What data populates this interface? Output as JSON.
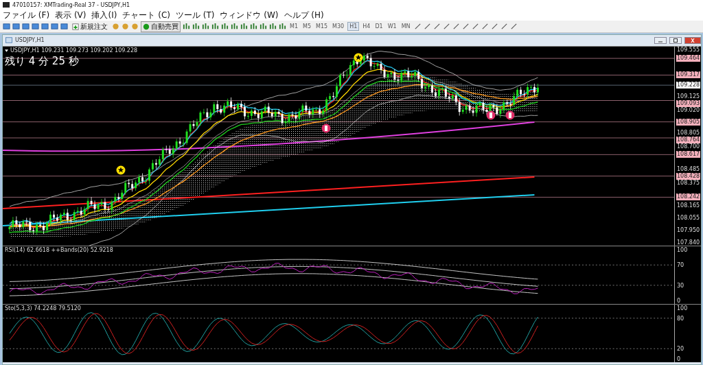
{
  "window": {
    "title": "47010157: XMTrading-Real 37 - USDJPY,H1"
  },
  "menu": [
    "ファイル (F)",
    "表示 (V)",
    "挿入(I)",
    "チャート (C)",
    "ツール (T)",
    "ウィンドウ (W)",
    "ヘルプ (H)"
  ],
  "toolbar": {
    "new_order": "新規注文",
    "auto_trading": {
      "label": "自動売買",
      "on": true
    },
    "timeframes": [
      {
        "label": "M1",
        "selected": false
      },
      {
        "label": "M5",
        "selected": false
      },
      {
        "label": "M15",
        "selected": false
      },
      {
        "label": "M30",
        "selected": false
      },
      {
        "label": "H1",
        "selected": true
      },
      {
        "label": "H4",
        "selected": false
      },
      {
        "label": "D1",
        "selected": false
      },
      {
        "label": "W1",
        "selected": false
      },
      {
        "label": "MN",
        "selected": false
      }
    ]
  },
  "chart_window": {
    "title": "USDJPY,H1",
    "header": "USDJPY,H1  109.231 109.273 109.202 109.228",
    "countdown": "残り 4 分 25 秒",
    "price_axis": [
      {
        "label": "109.555",
        "kind": "tick"
      },
      {
        "label": "109.464",
        "kind": "line"
      },
      {
        "label": "109.317",
        "kind": "line"
      },
      {
        "label": "109.228",
        "kind": "bid"
      },
      {
        "label": "109.125",
        "kind": "tick"
      },
      {
        "label": "109.093",
        "kind": "line"
      },
      {
        "label": "109.020",
        "kind": "tick"
      },
      {
        "label": "108.905",
        "kind": "line"
      },
      {
        "label": "108.805",
        "kind": "tick"
      },
      {
        "label": "108.764",
        "kind": "line"
      },
      {
        "label": "108.700",
        "kind": "tick"
      },
      {
        "label": "108.617",
        "kind": "line"
      },
      {
        "label": "108.485",
        "kind": "tick"
      },
      {
        "label": "108.428",
        "kind": "line"
      },
      {
        "label": "108.375",
        "kind": "tick"
      },
      {
        "label": "108.242",
        "kind": "line"
      },
      {
        "label": "108.165",
        "kind": "tick"
      },
      {
        "label": "108.055",
        "kind": "tick"
      },
      {
        "label": "107.950",
        "kind": "tick"
      },
      {
        "label": "107.840",
        "kind": "tick"
      }
    ],
    "rsi": {
      "label": "RSI(14) 62.6618  ++Bands(20) 52.9218",
      "axis": [
        "100",
        "70",
        "30",
        "0"
      ]
    },
    "stochastic": {
      "label": "Sto(5,3,3) 74.2248 79.5120",
      "axis": [
        "100",
        "80",
        "20",
        "0"
      ]
    }
  }
}
